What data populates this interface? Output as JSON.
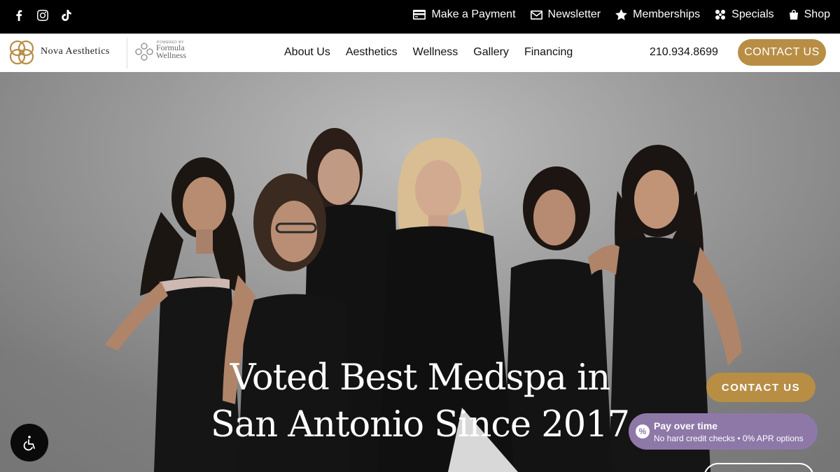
{
  "topbar": {
    "social": [
      {
        "name": "facebook-icon"
      },
      {
        "name": "instagram-icon"
      },
      {
        "name": "tiktok-icon"
      }
    ],
    "links": [
      {
        "label": "Make a Payment",
        "icon": "credit-card-icon"
      },
      {
        "label": "Newsletter",
        "icon": "envelope-icon"
      },
      {
        "label": "Memberships",
        "icon": "star-icon"
      },
      {
        "label": "Specials",
        "icon": "gift-icon"
      },
      {
        "label": "Shop",
        "icon": "shopping-bag-icon"
      }
    ]
  },
  "brand": {
    "name": "Nova Aesthetics",
    "partner_small": "POWERED BY",
    "partner_line1": "Formula",
    "partner_line2": "Wellness",
    "accent_color": "#b88e45"
  },
  "nav": {
    "items": [
      "About Us",
      "Aesthetics",
      "Wellness",
      "Gallery",
      "Financing"
    ],
    "phone": "210.934.8699",
    "contact_label": "CONTACT US"
  },
  "hero": {
    "headline_line1": "Voted Best Medspa in",
    "headline_line2": "San Antonio Since 2017",
    "contact_label": "CONTACT US",
    "pay_icon": "%",
    "pay_title": "Pay over time",
    "pay_subtitle": "No hard credit checks • 0% APR options",
    "pay_color": "#8e78a8"
  },
  "accessibility": {
    "icon": "accessibility-icon"
  }
}
